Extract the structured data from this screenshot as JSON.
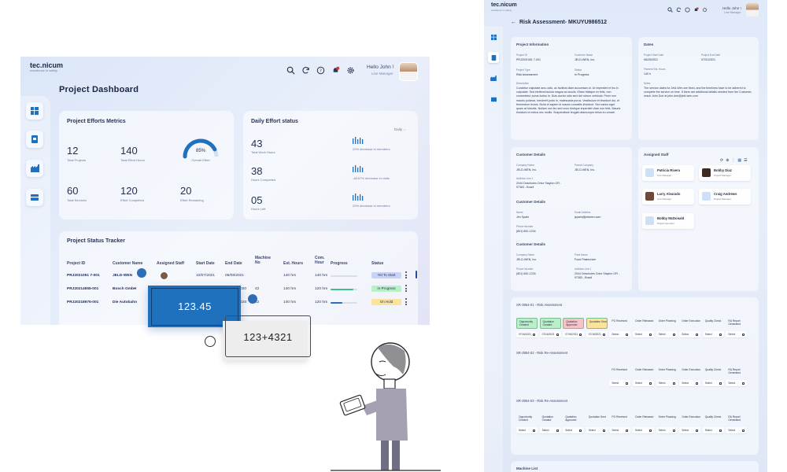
{
  "dashboard": {
    "logo": "tec.nicum",
    "logo_sub": "excellence in safety",
    "greeting": "Hello John !",
    "role": "Line Manager",
    "title": "Project  Dashboard",
    "metrics": {
      "title": "Project Efforts Metrics",
      "items": [
        {
          "value": "12",
          "label": "Total Projects"
        },
        {
          "value": "140",
          "label": "Total Effort Hours"
        },
        {
          "value": "60",
          "label": "Total Services"
        },
        {
          "value": "120",
          "label": "Effort Completed"
        },
        {
          "value": "20",
          "label": "Effort Remaining"
        }
      ],
      "gauge_value": "85%",
      "gauge_fraction": 0.85,
      "gauge_label": "Overall Effort"
    },
    "daily": {
      "title": "Daily Effort status",
      "filter": "Daily",
      "items": [
        {
          "value": "43",
          "label": "Total Work Hours",
          "note": "20% decrease in members"
        },
        {
          "value": "38",
          "label": "Hours Completed",
          "note": "-48.67% decrease in visits"
        },
        {
          "value": "05",
          "label": "Hours Left",
          "note": "20% decrease in members"
        }
      ]
    },
    "tracker": {
      "title": "Project Status Tracker",
      "headers": [
        "Project ID",
        "Customer Name",
        "Assigned Staff",
        "Start Date",
        "End Date",
        "Machine No",
        "Est. Hours",
        "Com. Hour",
        "Progress",
        "Status"
      ],
      "rows": [
        {
          "id": "PRJ2021051 7-001",
          "customer": "JELD-WEN",
          "start": "10/07/2021",
          "end": "06/08/2021",
          "machine": "",
          "est": "140 hrs",
          "com": "140 hrs",
          "progress": 0.0,
          "status": "Yet To Start"
        },
        {
          "id": "PRJ20214555-001",
          "customer": "Bosch GmbH",
          "start": "",
          "end": "/2020",
          "machine": "42",
          "est": "140 hrs",
          "com": "120 hrs",
          "progress": 0.85,
          "status": "In-Progress"
        },
        {
          "id": "PRJ20218975-001",
          "customer": "Die Autobahn",
          "start": "",
          "end": "07/2020",
          "machine": "42",
          "est": "140 hrs",
          "com": "120 hrs",
          "progress": 0.45,
          "status": "On Hold"
        }
      ]
    }
  },
  "overlays": {
    "blue_value": "123.45",
    "gray_value": "123+4321"
  },
  "colors": {
    "accent": "#1f71be",
    "status_yet": "#c9d3f7",
    "status_progress": "#b9efc9",
    "status_hold": "#fbe39a",
    "progress_green": "#3cc28a",
    "progress_blue": "#2f6db7"
  },
  "risk": {
    "logo": "tec.nicum",
    "logo_sub": "excellence in safety",
    "greeting": "Hello John !",
    "role": "Line Manager",
    "title": "Risk Assessment- MKUYU986512",
    "project_info": {
      "title": "Project Information",
      "fields": [
        {
          "label": "Project ID",
          "value": "PRJ2021051 7-001"
        },
        {
          "label": "Customer Name",
          "value": "JELD-WEN, Inc."
        },
        {
          "label": "Project Type",
          "value": "Risk Assessment"
        },
        {
          "label": "Status",
          "value": "In Progress"
        }
      ],
      "desc_label": "Description",
      "description": "Curabitur vulputate arcu odio, ac facilisis diam accumsan ut. Ut imperdiet et leo in vulputate. Sed eleifend lacinia magna ac iaculis. Etiam tristique ex felis, non consectetur purus luctus in. Duis auctor odio sed nisl rutrum vehicula. Proin non mauris pulvinar, hendrerit justo in, malesuada purus. Vestibulum et tincidunt dui, et fermentum lectus. Nulla et sapien id mauris convallis tincidunt. Sed varius eget quam at lobortis. Nullam non leo sed nunc tristique imperdiet vitae non felis. Mauris tincidunt ut metus nec mollis. Suspendisse feugiat ullamcorper tellus eu ornare."
    },
    "dates": {
      "title": "Dates",
      "fields": [
        {
          "label": "Project Start Date",
          "value": "06/25/2021"
        },
        {
          "label": "Project End Date",
          "value": "07/31/2021"
        },
        {
          "label": "Planned Est. Hours",
          "value": "140 h"
        }
      ],
      "notes_label": "Notes",
      "notes": "The service dates for Jeld-Wen are fixed, and the timelines have to be adhered to complete the service on time. If there are additional details needed from the Customer, reach John Doe at john.doe@jeld-wen.com"
    },
    "customer": {
      "title": "Customer Details",
      "company_label": "Company Name",
      "company": "JELD-WEN, Inc.",
      "parent_label": "Parent Company",
      "parent": "JELD-WEN, Inc.",
      "address_label": "Address Line 1",
      "address": "2044 Deschutes Drive Stayton OR - 97383 - Brazil",
      "contact_title": "Customer Details",
      "name_label": "Name",
      "name": "Jim Spahr",
      "email_label": "Email Address",
      "email": "jspahr@jeldwen.com",
      "phone_label": "Phone Number",
      "phone": "(801) 652-1234",
      "plant_title": "Customer Details",
      "plant_company_label": "Company Name",
      "plant_company": "JELD-WEN, Inc.",
      "plant_name_label": "Plant Name",
      "plant_name": "Food Pasteurizer",
      "plant_phone_label": "Phone Number",
      "plant_phone": "(801) 652-1234",
      "plant_address_label": "Address Line 1",
      "plant_address": "2044 Deschutes Drive Stayton OR - 97383 - Brazil"
    },
    "staff": {
      "title": "Assigned Staff",
      "members": [
        {
          "name": "Patricia Rivera",
          "role": "Line Manager"
        },
        {
          "name": "Bobby Diaz",
          "role": "Project Manager"
        },
        {
          "name": "Larry Alvarado",
          "role": "Line Manager"
        },
        {
          "name": "Craig Andrews",
          "role": "Project Manager"
        },
        {
          "name": "Bobby McDonald",
          "role": "Project Operator"
        }
      ]
    },
    "sr1": {
      "title": "SR-3954-01 - Risk Assessment",
      "stages": [
        "Opportunity Created",
        "Quotation Created",
        "Quotation Approved",
        "Quotation Sent",
        "PO Received",
        "Order Released",
        "Order Planning",
        "Order Execution",
        "Quality Check",
        "RA Report Generated"
      ],
      "values": [
        "07/16/2021",
        "07/16/2021",
        "07/16/2021",
        "07/16/2021",
        "Select",
        "Select",
        "Select",
        "Select",
        "Select",
        "Select"
      ]
    },
    "sr2": {
      "title": "SR-3954-02 - Risk Re-Assessment",
      "stages": [
        "PO Received",
        "Order Released",
        "Order Planning",
        "Order Execution",
        "Quality Check",
        "RA Report Generated"
      ],
      "values": [
        "Select",
        "Select",
        "Select",
        "Select",
        "Select",
        "Select"
      ]
    },
    "sr3": {
      "title": "SR-3954-03 - Risk Re-Assessment",
      "stages": [
        "Opportunity Created",
        "Quotation Created",
        "Quotation Approved",
        "Quotation Sent",
        "PO Received",
        "Order Released",
        "Order Planning",
        "Order Execution",
        "Quality Check",
        "RA Report Generated"
      ],
      "values": [
        "Select",
        "Select",
        "Select",
        "Select",
        "Select",
        "Select",
        "Select",
        "Select",
        "Select",
        "Select"
      ]
    },
    "machine_list": "Machine List"
  }
}
